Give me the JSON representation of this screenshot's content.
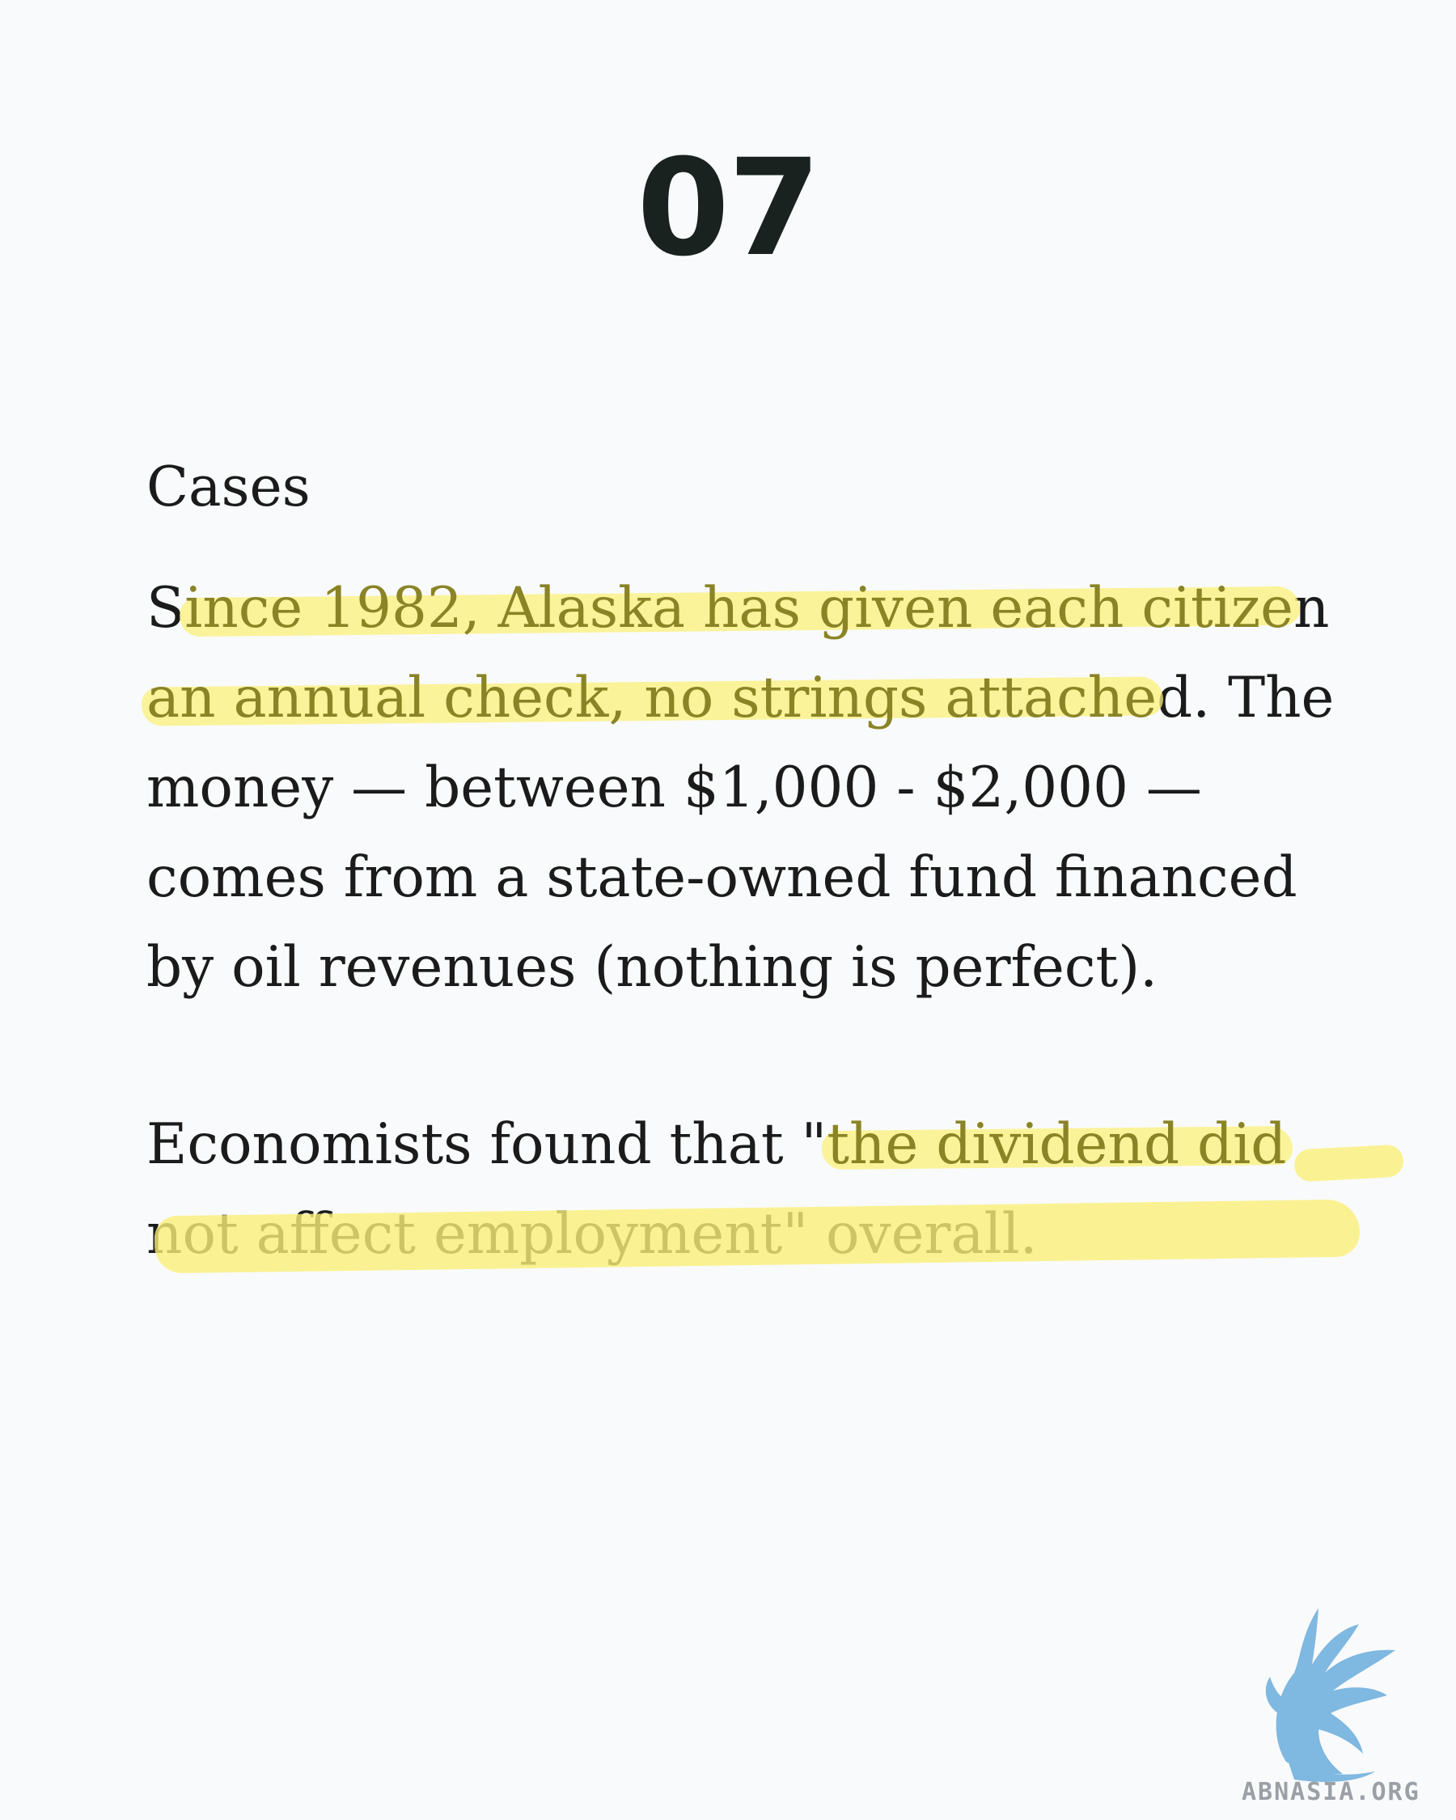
{
  "slide": {
    "number": "07"
  },
  "heading": "Cases",
  "paragraph1": {
    "line1_lead": "S",
    "line1_highlight": "ince 1982, Alaska has given each citize",
    "line1_tail": "n",
    "line2_highlight": "an annual check, no strings attache",
    "line2_tail": "d. The",
    "line3": "money — between $1,000 - $2,000 —",
    "line4": "comes from a state-owned fund financed",
    "line5": "by oil revenues (nothing is perfect)."
  },
  "paragraph2": {
    "line1_lead": "Economists  found that \"",
    "line1_highlight": "the dividend did",
    "line2": "not affect employment\" overall."
  },
  "brand": {
    "logo_icon": "griffin-icon",
    "text": "ABNASIA.ORG",
    "logo_color": "#7fb8e0",
    "highlight_color": "#faf078"
  }
}
